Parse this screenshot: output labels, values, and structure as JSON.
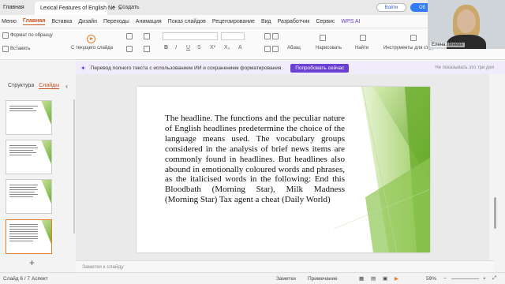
{
  "tabs": {
    "home": "Главная",
    "doc_title": "Lexical Features of English Ne",
    "new_tab": "Создать"
  },
  "account": {
    "login": "Войти",
    "share": "Об"
  },
  "menu": {
    "file": "Меню",
    "items": [
      "Главная",
      "Вставка",
      "Дизайн",
      "Переходы",
      "Анимация",
      "Показ слайдов",
      "Рецензирование",
      "Вид",
      "Разработчик",
      "Сервис"
    ],
    "wps_ai": "WPS AI"
  },
  "toolbar": {
    "format_painter": "Формат по образцу",
    "paste": "Вставить",
    "from_current": "С текущего слайда",
    "paragraph": "Абзац",
    "draw": "Нарисовать",
    "find": "Найти",
    "tools": "Инструменты для студентов"
  },
  "banner": {
    "text": "Перевод полного текста с использованием ИИ и сохранением форматирования.",
    "try_now": "Попробовать сейчас",
    "later": "Не показывать это три дня"
  },
  "left_panel": {
    "structure": "Структура",
    "slides": "Слайды",
    "thumbs": [
      "4",
      "5",
      "6",
      "7"
    ]
  },
  "slide": {
    "text": "The headline. The functions and the peculiar nature of English headlines predetermine the choice of the language means used. The vocabulary groups considered in the analysis of brief news items are commonly found in headlines. But headlines also abound in emotionally coloured words and phrases, as the italicised words in the following: End this Bloodbath (Morning Star), Milk Madness (Morning Star) Tax agent a cheat (Daily World)"
  },
  "notes": {
    "placeholder": "Заметки к слайду"
  },
  "status": {
    "slide_count": "Слайд 6 / 7",
    "aspect": "Аспект",
    "notes": "Заметки",
    "comment": "Примечание",
    "zoom": "59%"
  },
  "webcam": {
    "name": "Елена Линева"
  },
  "colors": {
    "accent": "#c8541d",
    "ai_purple": "#6b3fd1",
    "slide_green": "#6cae2e"
  }
}
